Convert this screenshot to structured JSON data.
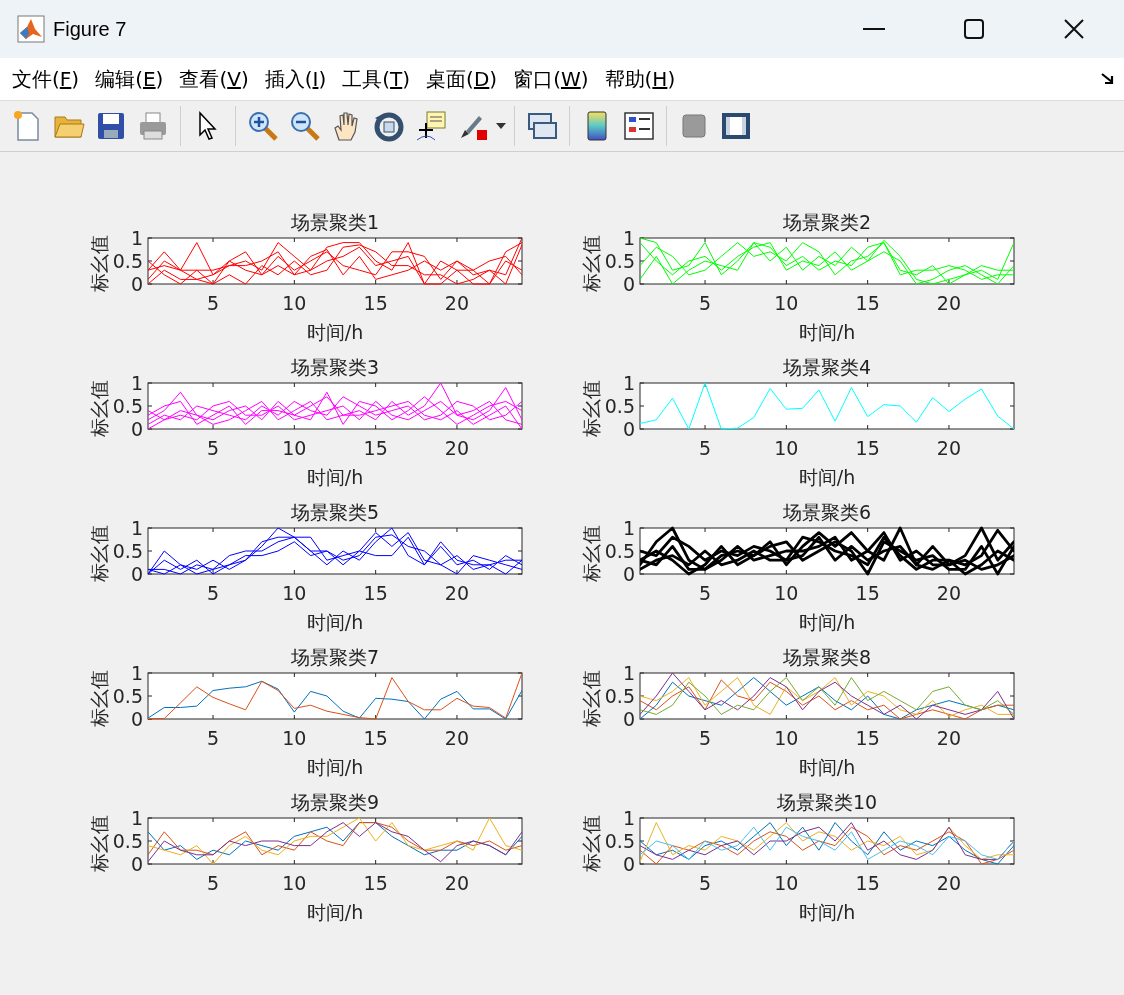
{
  "window": {
    "title": "Figure 7"
  },
  "menu": [
    {
      "label": "文件(F)"
    },
    {
      "label": "编辑(E)"
    },
    {
      "label": "查看(V)"
    },
    {
      "label": "插入(I)"
    },
    {
      "label": "工具(T)"
    },
    {
      "label": "桌面(D)"
    },
    {
      "label": "窗口(W)"
    },
    {
      "label": "帮助(H)"
    }
  ],
  "plots": [
    {
      "thick_lines": false,
      "chart_data": {
        "type": "line",
        "title": "场景聚类1",
        "xlabel": "时间/h",
        "ylabel": "标幺值",
        "x": [
          1,
          2,
          3,
          4,
          5,
          6,
          7,
          8,
          9,
          10,
          11,
          12,
          13,
          14,
          15,
          16,
          17,
          18,
          19,
          20,
          21,
          22,
          23,
          24
        ],
        "xlim": [
          1,
          24
        ],
        "ylim": [
          0,
          1
        ],
        "xticks": [
          5,
          10,
          15,
          20
        ],
        "yticks": [
          0,
          0.5,
          1
        ],
        "series": [
          {
            "color": "#ff0000",
            "values": [
              0.3,
              0.7,
              0.3,
              0.9,
              0.2,
              0.4,
              0.5,
              0.3,
              0.9,
              0.6,
              0.3,
              0.8,
              0.9,
              0.9,
              0.5,
              0.3,
              0.9,
              0.0,
              0.5,
              0.3,
              0.3,
              0.0,
              0.7,
              0.9
            ]
          },
          {
            "color": "#ff0000",
            "values": [
              0.1,
              0.5,
              0.3,
              0.3,
              0.0,
              0.5,
              0.7,
              0.2,
              0.6,
              0.3,
              0.5,
              0.7,
              0.4,
              0.3,
              0.2,
              0.7,
              0.7,
              0.6,
              0.1,
              0.5,
              0.2,
              0.3,
              0.2,
              1
            ]
          },
          {
            "color": "#ff0000",
            "values": [
              0.5,
              0.2,
              0.0,
              0.3,
              0.3,
              0.4,
              0.4,
              0.5,
              0.7,
              0.2,
              0.3,
              0.5,
              0.6,
              0.8,
              0.4,
              0.5,
              0.6,
              0.0,
              0.0,
              0.3,
              0.0,
              0.0,
              0.5,
              0.3
            ]
          },
          {
            "color": "#ff0000",
            "values": [
              0.0,
              0.3,
              0.1,
              0.1,
              0.2,
              0.5,
              0.3,
              0.2,
              0.4,
              0.2,
              0.6,
              0.75,
              0.2,
              0.6,
              0.1,
              0.2,
              0.3,
              0.5,
              0.3,
              0.5,
              0.3,
              0.5,
              0.6,
              0.2
            ]
          },
          {
            "color": "#ff0000",
            "values": [
              0.3,
              0.4,
              0.3,
              0.1,
              0.0,
              0.2,
              0.0,
              0.4,
              0.2,
              0.5,
              0.2,
              0.3,
              0.8,
              0.85,
              0.7,
              0.4,
              0.4,
              0.2,
              0.2,
              0.0,
              0.1,
              0.3,
              0.0,
              0.85
            ]
          }
        ]
      }
    },
    {
      "thick_lines": false,
      "chart_data": {
        "type": "line",
        "title": "场景聚类2",
        "xlabel": "时间/h",
        "ylabel": "标幺值",
        "x": [
          1,
          2,
          3,
          4,
          5,
          6,
          7,
          8,
          9,
          10,
          11,
          12,
          13,
          14,
          15,
          16,
          17,
          18,
          19,
          20,
          21,
          22,
          23,
          24
        ],
        "xlim": [
          1,
          24
        ],
        "ylim": [
          0,
          1
        ],
        "xticks": [
          5,
          10,
          15,
          20
        ],
        "yticks": [
          0,
          0.5,
          1
        ],
        "series": [
          {
            "color": "#00ff00",
            "values": [
              1,
              0.9,
              0.3,
              0.4,
              0.9,
              0.2,
              0.5,
              0.9,
              0.8,
              0.4,
              0.6,
              0.3,
              0.5,
              0.4,
              0.8,
              0.9,
              0.3,
              0.2,
              0.4,
              0.0,
              0.2,
              0.3,
              0.1,
              0.9
            ]
          },
          {
            "color": "#00ff00",
            "values": [
              0.1,
              0.6,
              0.0,
              0.3,
              0.5,
              0.4,
              0.3,
              0.9,
              0.5,
              0.8,
              0.3,
              0.6,
              0.4,
              0.8,
              0.5,
              0.95,
              0.6,
              0.1,
              0.0,
              0.1,
              0.2,
              0.4,
              0.3,
              0.3
            ]
          },
          {
            "color": "#00ff00",
            "values": [
              0.4,
              0.8,
              0.6,
              0.2,
              0.3,
              0.6,
              0.9,
              0.6,
              0.7,
              0.5,
              0.9,
              0.7,
              0.2,
              0.5,
              0.6,
              0.9,
              0.2,
              0.3,
              0.3,
              0.4,
              0.3,
              0.1,
              0.2,
              0.2
            ]
          },
          {
            "color": "#00ff00",
            "values": [
              0.9,
              0.5,
              0.2,
              0.5,
              0.6,
              0.3,
              0.6,
              0.8,
              0.9,
              0.3,
              0.5,
              0.4,
              0.7,
              0.3,
              0.5,
              0.7,
              0.5,
              0.0,
              0.1,
              0.3,
              0.4,
              0.2,
              0.0,
              0.4
            ]
          }
        ]
      }
    },
    {
      "thick_lines": false,
      "chart_data": {
        "type": "line",
        "title": "场景聚类3",
        "xlabel": "时间/h",
        "ylabel": "标幺值",
        "x": [
          1,
          2,
          3,
          4,
          5,
          6,
          7,
          8,
          9,
          10,
          11,
          12,
          13,
          14,
          15,
          16,
          17,
          18,
          19,
          20,
          21,
          22,
          23,
          24
        ],
        "xlim": [
          1,
          24
        ],
        "ylim": [
          0,
          1
        ],
        "xticks": [
          5,
          10,
          15,
          20
        ],
        "yticks": [
          0,
          0.5,
          1
        ],
        "series": [
          {
            "color": "#ff00ff",
            "values": [
              0.2,
              0.4,
              0.8,
              0.3,
              0.2,
              0.4,
              0.5,
              0.2,
              0.6,
              0.3,
              0.5,
              0.7,
              0.3,
              0.4,
              0.2,
              0.6,
              0.3,
              0.5,
              1,
              0.3,
              0.2,
              0.4,
              0.9,
              0.2
            ]
          },
          {
            "color": "#ff00ff",
            "values": [
              0.1,
              0.3,
              0.2,
              0.5,
              0.4,
              0.3,
              0.2,
              0.5,
              0.3,
              0.6,
              0.4,
              0.3,
              0.7,
              0.5,
              0.3,
              0.4,
              0.5,
              0.2,
              0.3,
              0.6,
              0.5,
              0.2,
              0.3,
              0.6
            ]
          },
          {
            "color": "#ff00ff",
            "values": [
              0.4,
              0.2,
              0.3,
              0.2,
              0.5,
              0.6,
              0.3,
              0.3,
              0.5,
              0.2,
              0.3,
              0.4,
              0.5,
              0.2,
              0.6,
              0.3,
              0.2,
              0.4,
              0.6,
              0.3,
              0.4,
              0.6,
              0.2,
              0.1
            ]
          },
          {
            "color": "#ff00ff",
            "values": [
              0.0,
              0.2,
              0.4,
              0.3,
              0.1,
              0.2,
              0.4,
              0.6,
              0.2,
              0.4,
              0.6,
              0.2,
              0.3,
              0.3,
              0.4,
              0.5,
              0.6,
              0.3,
              0.2,
              0.4,
              0.1,
              0.3,
              0.5,
              0.0
            ]
          },
          {
            "color": "#ff00ff",
            "values": [
              0.3,
              0.5,
              0.6,
              0.1,
              0.3,
              0.5,
              0.1,
              0.4,
              0.4,
              0.3,
              0.2,
              0.8,
              0.1,
              0.6,
              0.5,
              0.2,
              0.4,
              0.7,
              0.4,
              0.1,
              0.3,
              0.5,
              0.6,
              0.4
            ]
          }
        ]
      }
    },
    {
      "thick_lines": false,
      "chart_data": {
        "type": "line",
        "title": "场景聚类4",
        "xlabel": "时间/h",
        "ylabel": "标幺值",
        "x": [
          1,
          2,
          3,
          4,
          5,
          6,
          7,
          8,
          9,
          10,
          11,
          12,
          13,
          14,
          15,
          16,
          17,
          18,
          19,
          20,
          21,
          22,
          23,
          24
        ],
        "xlim": [
          1,
          24
        ],
        "ylim": [
          0,
          1
        ],
        "xticks": [
          5,
          10,
          15,
          20
        ],
        "yticks": [
          0,
          0.5,
          1
        ],
        "series": [
          {
            "color": "#00ffff",
            "values": [
              0.12,
              0.2,
              0.67,
              0,
              1,
              0,
              0.02,
              0.25,
              0.88,
              0.43,
              0.45,
              0.85,
              0.17,
              0.9,
              0.27,
              0.53,
              0.5,
              0.15,
              0.68,
              0.38,
              0.65,
              0.87,
              0.28,
              0
            ]
          }
        ]
      }
    },
    {
      "thick_lines": false,
      "chart_data": {
        "type": "line",
        "title": "场景聚类5",
        "xlabel": "时间/h",
        "ylabel": "标幺值",
        "x": [
          1,
          2,
          3,
          4,
          5,
          6,
          7,
          8,
          9,
          10,
          11,
          12,
          13,
          14,
          15,
          16,
          17,
          18,
          19,
          20,
          21,
          22,
          23,
          24
        ],
        "xlim": [
          1,
          24
        ],
        "ylim": [
          0,
          1
        ],
        "xticks": [
          5,
          10,
          15,
          20
        ],
        "yticks": [
          0,
          0.5,
          1
        ],
        "series": [
          {
            "color": "#0000ff",
            "values": [
              0.0,
              0.5,
              0.2,
              0.1,
              0.3,
              0.1,
              0.3,
              0.6,
              1,
              0.8,
              0.5,
              0.2,
              0.5,
              0.3,
              0.7,
              1,
              0.4,
              0.2,
              0.6,
              0.2,
              0.3,
              0.1,
              0.4,
              0.2
            ]
          },
          {
            "color": "#0000ff",
            "values": [
              0.1,
              0.0,
              0.2,
              0.0,
              0.1,
              0.4,
              0.5,
              0.5,
              0.7,
              0.8,
              0.8,
              0.3,
              0.4,
              0.5,
              0.9,
              0.6,
              0.9,
              0.3,
              0.2,
              0.4,
              0.1,
              0.2,
              0.3,
              0.3
            ]
          },
          {
            "color": "#0000ff",
            "values": [
              0.0,
              0.3,
              0.1,
              0.3,
              0.0,
              0.2,
              0.3,
              0.7,
              0.8,
              0.8,
              0.5,
              0.5,
              0.3,
              0.4,
              0.8,
              0.85,
              0.6,
              0.5,
              0.2,
              0.0,
              0.4,
              0.3,
              0.2,
              0.1
            ]
          },
          {
            "color": "#0000ff",
            "values": [
              0.1,
              0.1,
              0.0,
              0.2,
              0.1,
              0.2,
              0.4,
              0.4,
              0.5,
              0.7,
              0.4,
              0.5,
              0.2,
              0.5,
              0.4,
              0.4,
              0.8,
              0.2,
              0.7,
              0.3,
              0.2,
              0.2,
              0.0,
              0.3
            ]
          }
        ]
      }
    },
    {
      "thick_lines": true,
      "chart_data": {
        "type": "line",
        "title": "场景聚类6",
        "xlabel": "时间/h",
        "ylabel": "标幺值",
        "x": [
          1,
          2,
          3,
          4,
          5,
          6,
          7,
          8,
          9,
          10,
          11,
          12,
          13,
          14,
          15,
          16,
          17,
          18,
          19,
          20,
          21,
          22,
          23,
          24
        ],
        "xlim": [
          1,
          24
        ],
        "ylim": [
          0,
          1
        ],
        "xticks": [
          5,
          10,
          15,
          20
        ],
        "yticks": [
          0,
          0.5,
          1
        ],
        "series": [
          {
            "color": "#000000",
            "values": [
              0.2,
              0.7,
              1,
              0.3,
              0.1,
              0.4,
              0.5,
              0.4,
              0.7,
              0.2,
              0.6,
              0.9,
              0.6,
              0.9,
              0.5,
              0.3,
              1,
              0.2,
              0.6,
              0.2,
              0.4,
              1,
              0.3,
              0.7
            ]
          },
          {
            "color": "#000000",
            "values": [
              0.5,
              0.4,
              0.8,
              0.6,
              0.3,
              0.5,
              0.4,
              0.6,
              0.5,
              0.3,
              0.8,
              0.7,
              0.5,
              0.4,
              0.2,
              0.8,
              0.4,
              0.1,
              0.3,
              0.3,
              0.2,
              0.4,
              0.95,
              0.5
            ]
          },
          {
            "color": "#000000",
            "values": [
              0.3,
              0.2,
              0.6,
              0.1,
              0.1,
              0.3,
              0.6,
              0.3,
              0.4,
              0.5,
              0.5,
              0.6,
              0.8,
              0.3,
              0.5,
              0.9,
              0.3,
              0.5,
              0.2,
              0.2,
              0.3,
              0.1,
              0.2,
              0.4
            ]
          },
          {
            "color": "#000000",
            "values": [
              0.1,
              0.3,
              0.4,
              0.2,
              0.5,
              0.2,
              0.3,
              0.5,
              0.3,
              0.3,
              0.4,
              0.8,
              0.3,
              0.6,
              0.3,
              0.5,
              0.6,
              0.2,
              0.1,
              0.3,
              0.0,
              0.2,
              0.5,
              0.3
            ]
          },
          {
            "color": "#000000",
            "values": [
              0.3,
              0.5,
              0.3,
              0.0,
              0.2,
              0.6,
              0.2,
              0.4,
              0.6,
              0.7,
              0.3,
              0.5,
              0.7,
              0.5,
              0.0,
              0.7,
              0.5,
              0.3,
              0.4,
              0.1,
              0.1,
              0.6,
              0.0,
              0.6
            ]
          }
        ]
      }
    },
    {
      "thick_lines": false,
      "chart_data": {
        "type": "line",
        "title": "场景聚类7",
        "xlabel": "时间/h",
        "ylabel": "标幺值",
        "x": [
          1,
          2,
          3,
          4,
          5,
          6,
          7,
          8,
          9,
          10,
          11,
          12,
          13,
          14,
          15,
          16,
          17,
          18,
          19,
          20,
          21,
          22,
          23,
          24
        ],
        "xlim": [
          1,
          24
        ],
        "ylim": [
          0,
          1
        ],
        "xticks": [
          5,
          10,
          15,
          20
        ],
        "yticks": [
          0,
          0.5,
          1
        ],
        "series": [
          {
            "color": "#0072bd",
            "values": [
              0.02,
              0.25,
              0.25,
              0.28,
              0.62,
              0.67,
              0.7,
              0.82,
              0.65,
              0.15,
              0.6,
              0.5,
              0.17,
              0.02,
              0.45,
              0.43,
              0.38,
              0,
              0.43,
              0.6,
              0.22,
              0.22,
              0,
              0.62
            ]
          },
          {
            "color": "#d95319",
            "values": [
              0.01,
              0.01,
              0.35,
              0.7,
              0.47,
              0.33,
              0.2,
              0.82,
              0.62,
              0.23,
              0.3,
              0.17,
              0.1,
              0.03,
              0,
              0.9,
              0.38,
              0.2,
              0.2,
              0.45,
              0.28,
              0.25,
              0.02,
              1
            ]
          }
        ]
      }
    },
    {
      "thick_lines": false,
      "chart_data": {
        "type": "line",
        "title": "场景聚类8",
        "xlabel": "时间/h",
        "ylabel": "标幺值",
        "x": [
          1,
          2,
          3,
          4,
          5,
          6,
          7,
          8,
          9,
          10,
          11,
          12,
          13,
          14,
          15,
          16,
          17,
          18,
          19,
          20,
          21,
          22,
          23,
          24
        ],
        "xlim": [
          1,
          24
        ],
        "ylim": [
          0,
          1
        ],
        "xticks": [
          5,
          10,
          15,
          20
        ],
        "yticks": [
          0,
          0.5,
          1
        ],
        "series": [
          {
            "color": "#0072bd",
            "values": [
              0.0,
              0.3,
              0.8,
              0.5,
              0.4,
              0.3,
              0.6,
              0.9,
              0.6,
              0.3,
              0.5,
              0.7,
              0.4,
              0.2,
              0.5,
              0.1,
              0.0,
              0.2,
              0.3,
              0.4,
              0.3,
              0.2,
              0.3,
              0.2
            ]
          },
          {
            "color": "#d95319",
            "values": [
              0.4,
              0.2,
              0.5,
              0.7,
              0.2,
              0.85,
              0.5,
              0.4,
              0.8,
              0.6,
              0.3,
              0.5,
              0.2,
              0.4,
              0.2,
              0.3,
              0.0,
              0.1,
              0.2,
              0.1,
              0.0,
              0.2,
              0.3,
              0.3
            ]
          },
          {
            "color": "#edb120",
            "values": [
              0.5,
              0.4,
              0.6,
              0.9,
              0.3,
              0.6,
              0.9,
              0.3,
              0.1,
              0.7,
              0.4,
              0.6,
              0.9,
              0.3,
              0.6,
              0.5,
              0.2,
              0.1,
              0.4,
              0.05,
              0.2,
              0.3,
              0.1,
              0.1
            ]
          },
          {
            "color": "#7e2f8e",
            "values": [
              0.1,
              0.5,
              1,
              0.6,
              0.2,
              0.4,
              0.2,
              0.5,
              0.9,
              0.7,
              0.2,
              0.6,
              0.8,
              0.5,
              0.3,
              0.1,
              0.3,
              0.0,
              0.3,
              0.2,
              0.1,
              0.2,
              0.6,
              0.0
            ]
          },
          {
            "color": "#77ac30",
            "values": [
              0.2,
              0.1,
              0.3,
              0.8,
              0.5,
              0.1,
              0.3,
              0.2,
              0.6,
              0.9,
              0.4,
              0.7,
              0.3,
              0.9,
              0.4,
              0.6,
              0.4,
              0.2,
              0.6,
              0.7,
              0.3,
              0.2,
              0.4,
              0.1
            ]
          }
        ]
      }
    },
    {
      "thick_lines": false,
      "chart_data": {
        "type": "line",
        "title": "场景聚类9",
        "xlabel": "时间/h",
        "ylabel": "标幺值",
        "x": [
          1,
          2,
          3,
          4,
          5,
          6,
          7,
          8,
          9,
          10,
          11,
          12,
          13,
          14,
          15,
          16,
          17,
          18,
          19,
          20,
          21,
          22,
          23,
          24
        ],
        "xlim": [
          1,
          24
        ],
        "ylim": [
          0,
          1
        ],
        "xticks": [
          5,
          10,
          15,
          20
        ],
        "yticks": [
          0,
          0.5,
          1
        ],
        "series": [
          {
            "color": "#0072bd",
            "values": [
              0.7,
              0.3,
              0.4,
              0.1,
              0.3,
              0.2,
              0.5,
              0.4,
              0.3,
              0.6,
              0.7,
              0.8,
              0.5,
              0.9,
              0.9,
              0.6,
              0.4,
              0.2,
              0.3,
              0.3,
              0.5,
              0.4,
              0.2,
              0.6
            ]
          },
          {
            "color": "#d95319",
            "values": [
              0.2,
              0.7,
              0.3,
              0.3,
              0.2,
              0.5,
              0.7,
              0.2,
              0.4,
              0.3,
              0.7,
              0.5,
              0.4,
              0.9,
              0.9,
              0.8,
              0.5,
              0.3,
              0.3,
              0.5,
              0.4,
              0.5,
              0.3,
              0.4
            ]
          },
          {
            "color": "#edb120",
            "values": [
              0.4,
              0.3,
              0.2,
              0.4,
              0.0,
              0.4,
              0.6,
              0.3,
              0.2,
              0.5,
              0.6,
              0.6,
              0.8,
              1,
              0.5,
              0.9,
              0.4,
              0.3,
              0.4,
              0.5,
              0.3,
              1,
              0.4,
              0.3
            ]
          },
          {
            "color": "#7e2f8e",
            "values": [
              0.05,
              0.5,
              0.3,
              0.2,
              0.2,
              0.5,
              0.4,
              0.5,
              0.5,
              0.4,
              0.4,
              0.7,
              0.9,
              0.6,
              0.9,
              0.7,
              0.6,
              0.3,
              0.05,
              0.4,
              0.5,
              0.4,
              0.2,
              0.7
            ]
          }
        ]
      }
    },
    {
      "thick_lines": false,
      "chart_data": {
        "type": "line",
        "title": "场景聚类10",
        "xlabel": "时间/h",
        "ylabel": "标幺值",
        "x": [
          1,
          2,
          3,
          4,
          5,
          6,
          7,
          8,
          9,
          10,
          11,
          12,
          13,
          14,
          15,
          16,
          17,
          18,
          19,
          20,
          21,
          22,
          23,
          24
        ],
        "xlim": [
          1,
          24
        ],
        "ylim": [
          0,
          1
        ],
        "xticks": [
          5,
          10,
          15,
          20
        ],
        "yticks": [
          0,
          0.5,
          1
        ],
        "series": [
          {
            "color": "#0072bd",
            "values": [
              0.5,
              0.2,
              0.3,
              0.1,
              0.4,
              0.5,
              0.3,
              0.6,
              0.9,
              0.4,
              0.8,
              0.3,
              0.9,
              0.5,
              0.2,
              0.7,
              0.3,
              0.5,
              0.4,
              0.6,
              0.3,
              0.1,
              0.0,
              0.4
            ]
          },
          {
            "color": "#d95319",
            "values": [
              0.3,
              0.0,
              0.4,
              0.3,
              0.5,
              0.4,
              0.2,
              0.5,
              0.7,
              0.6,
              0.3,
              0.5,
              0.4,
              0.8,
              0.6,
              0.2,
              0.4,
              0.3,
              0.5,
              0.7,
              0.5,
              0.0,
              0.1,
              0.3
            ]
          },
          {
            "color": "#edb120",
            "values": [
              0.05,
              0.9,
              0.2,
              0.4,
              0.3,
              0.6,
              0.5,
              0.3,
              0.6,
              0.9,
              0.5,
              0.7,
              0.6,
              0.3,
              0.5,
              0.4,
              0.6,
              0.2,
              0.3,
              0.8,
              0.4,
              0.1,
              0.2,
              0.2
            ]
          },
          {
            "color": "#7e2f8e",
            "values": [
              0.4,
              0.2,
              0.1,
              0.3,
              0.2,
              0.4,
              0.5,
              0.2,
              0.5,
              0.5,
              0.7,
              0.8,
              0.5,
              0.9,
              0.3,
              0.5,
              0.2,
              0.1,
              0.3,
              0.8,
              0.2,
              0.1,
              0.1,
              0.5
            ]
          },
          {
            "color": "#4dbeee",
            "values": [
              0.2,
              0.5,
              0.4,
              0.1,
              0.5,
              0.3,
              0.4,
              0.8,
              0.3,
              0.8,
              0.6,
              0.5,
              0.3,
              0.7,
              0.1,
              0.3,
              0.5,
              0.4,
              0.2,
              0.6,
              0.5,
              0.2,
              0.1,
              0.5
            ]
          }
        ]
      }
    }
  ]
}
